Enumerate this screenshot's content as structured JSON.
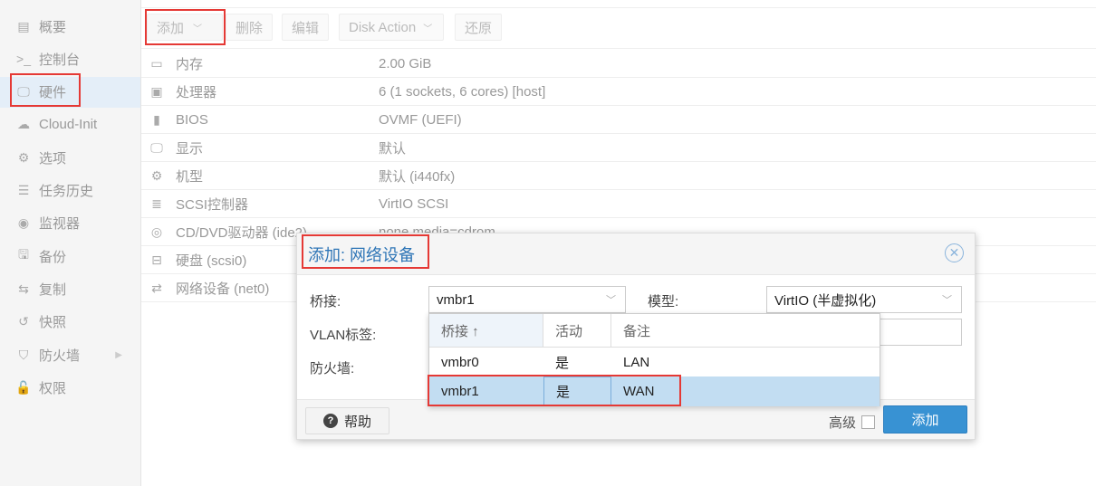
{
  "sidebar": {
    "items": [
      {
        "icon": "book-icon",
        "glyph": "▤",
        "label": "概要"
      },
      {
        "icon": "terminal-icon",
        "glyph": ">_",
        "label": "控制台"
      },
      {
        "icon": "monitor-icon",
        "glyph": "🖵",
        "label": "硬件",
        "active": true
      },
      {
        "icon": "cloud-icon",
        "glyph": "☁",
        "label": "Cloud-Init"
      },
      {
        "icon": "gear-icon",
        "glyph": "⚙",
        "label": "选项"
      },
      {
        "icon": "list-icon",
        "glyph": "☰",
        "label": "任务历史"
      },
      {
        "icon": "eye-icon",
        "glyph": "◉",
        "label": "监视器"
      },
      {
        "icon": "floppy-icon",
        "glyph": "🖫",
        "label": "备份"
      },
      {
        "icon": "retweet-icon",
        "glyph": "⇆",
        "label": "复制"
      },
      {
        "icon": "history-icon",
        "glyph": "↺",
        "label": "快照"
      },
      {
        "icon": "shield-icon",
        "glyph": "⛉",
        "label": "防火墙"
      },
      {
        "icon": "unlock-icon",
        "glyph": "🔓",
        "label": "权限"
      }
    ]
  },
  "toolbar": {
    "add": "添加",
    "remove": "删除",
    "edit": "编辑",
    "disk_action": "Disk Action",
    "revert": "还原"
  },
  "hardware": [
    {
      "icon": "memory-icon",
      "glyph": "▭",
      "key": "内存",
      "value": "2.00 GiB"
    },
    {
      "icon": "cpu-icon",
      "glyph": "▣",
      "key": "处理器",
      "value": "6 (1 sockets, 6 cores) [host]"
    },
    {
      "icon": "chip-icon",
      "glyph": "▮",
      "key": "BIOS",
      "value": "OVMF (UEFI)"
    },
    {
      "icon": "desktop-icon",
      "glyph": "🖵",
      "key": "显示",
      "value": "默认"
    },
    {
      "icon": "cogs-icon",
      "glyph": "⚙",
      "key": "机型",
      "value": "默认 (i440fx)"
    },
    {
      "icon": "database-icon",
      "glyph": "≣",
      "key": "SCSI控制器",
      "value": "VirtIO SCSI"
    },
    {
      "icon": "cdrom-icon",
      "glyph": "◎",
      "key": "CD/DVD驱动器 (ide2)",
      "value": "none,media=cdrom"
    },
    {
      "icon": "hdd-icon",
      "glyph": "⊟",
      "key": "硬盘 (scsi0)",
      "value": ""
    },
    {
      "icon": "exchange-icon",
      "glyph": "⇄",
      "key": "网络设备 (net0)",
      "value": ""
    }
  ],
  "dialog": {
    "title": "添加: 网络设备",
    "bridge_label": "桥接:",
    "bridge_value": "vmbr1",
    "model_label": "模型:",
    "model_value": "VirtIO (半虚拟化)",
    "vlan_label": "VLAN标签:",
    "firewall_label": "防火墙:",
    "help": "帮助",
    "advanced": "高级",
    "add": "添加",
    "grid": {
      "headers": [
        "桥接 ↑",
        "活动",
        "备注"
      ],
      "rows": [
        {
          "bridge": "vmbr0",
          "active": "是",
          "comment": "LAN"
        },
        {
          "bridge": "vmbr1",
          "active": "是",
          "comment": "WAN",
          "selected": true
        }
      ]
    }
  },
  "colors": {
    "accent": "#3892d3",
    "title": "#2e75b6",
    "highlight": "#e53935",
    "selected_row": "#c2ddf2"
  }
}
